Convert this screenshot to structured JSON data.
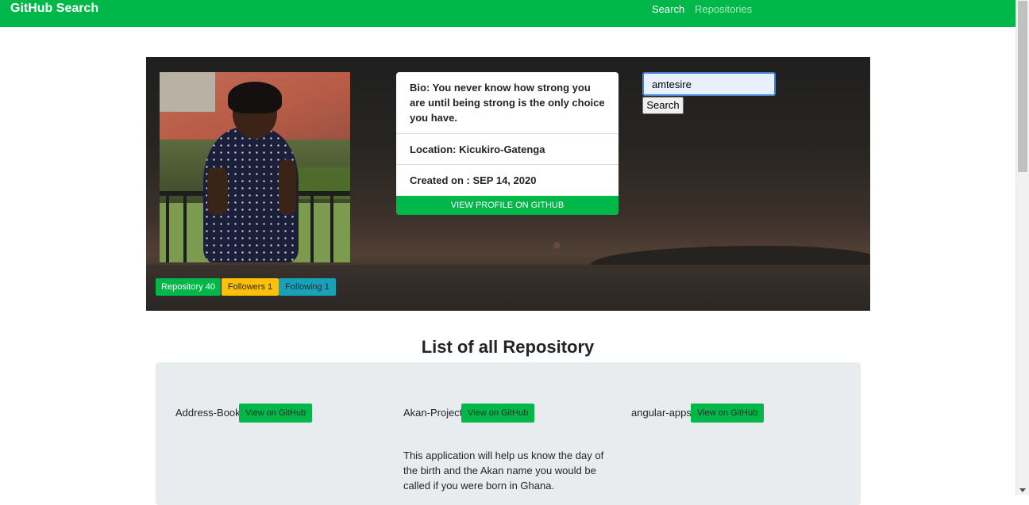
{
  "navbar": {
    "brand": "GitHub Search",
    "links": [
      {
        "label": "Search",
        "active": true
      },
      {
        "label": "Repositories",
        "active": false
      }
    ]
  },
  "profile": {
    "bio": "Bio: You never know how strong you are until being strong is the only choice you have.",
    "location": "Location: Kicukiro-Gatenga",
    "created": "Created on : SEP 14, 2020",
    "view_profile_label": "VIEW PROFILE ON GITHUB"
  },
  "search": {
    "value": "amtesire",
    "button_label": "Search"
  },
  "badges": [
    {
      "label": "Repository 40",
      "color": "#00b84a"
    },
    {
      "label": "Followers 1",
      "color": "#ffc107"
    },
    {
      "label": "Following 1",
      "color": "#17a2b8"
    }
  ],
  "repositories": {
    "title": "List of all Repository",
    "items": [
      {
        "name": "Address-Book",
        "button_label": "View on GitHub",
        "description": ""
      },
      {
        "name": "Akan-Project",
        "button_label": "View on GitHub",
        "description": "This application will help us know the day of the birth and the Akan name you would be called if you were born in Ghana."
      },
      {
        "name": "angular-apps",
        "button_label": "View on GitHub",
        "description": ""
      }
    ]
  },
  "colors": {
    "accent": "#00b84a",
    "warning": "#ffc107",
    "info": "#17a2b8"
  }
}
